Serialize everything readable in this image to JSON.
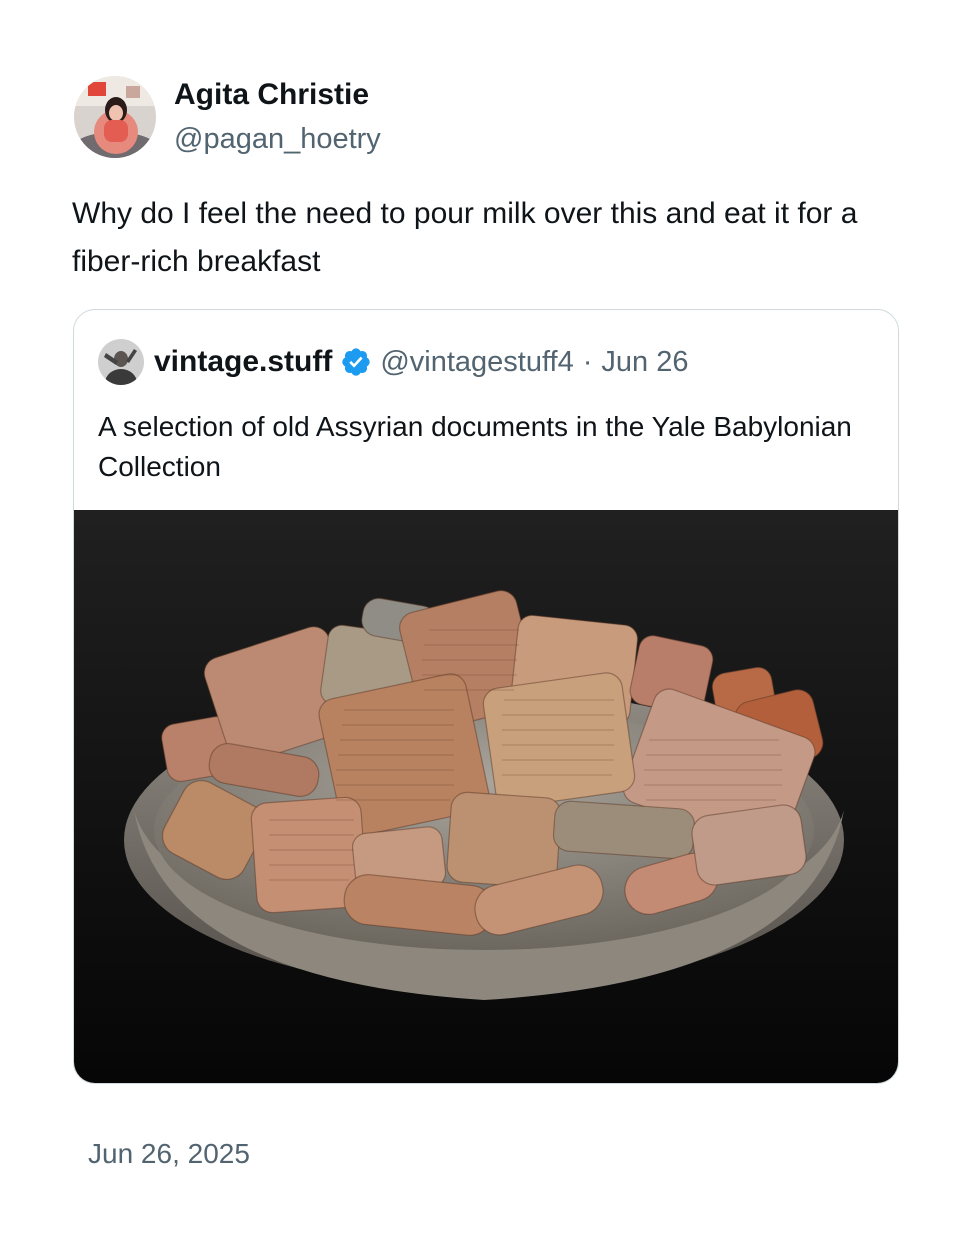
{
  "post": {
    "author": {
      "display_name": "Agita Christie",
      "handle": "@pagan_hoetry"
    },
    "text": "Why do I feel the need to pour milk over this and eat it for a fiber-rich breakfast",
    "timestamp": "Jun 26, 2025"
  },
  "quoted_post": {
    "author": {
      "display_name": "vintage.stuff",
      "handle": "@vintagestuff4",
      "verified": true
    },
    "separator": "·",
    "date": "Jun 26",
    "text": "A selection of old Assyrian documents in the Yale Babylonian Collection",
    "media_icon": "photo"
  },
  "colors": {
    "text_primary": "#0f1419",
    "text_secondary": "#536471",
    "border": "#cfd9de",
    "verified_badge": "#1d9bf0"
  }
}
